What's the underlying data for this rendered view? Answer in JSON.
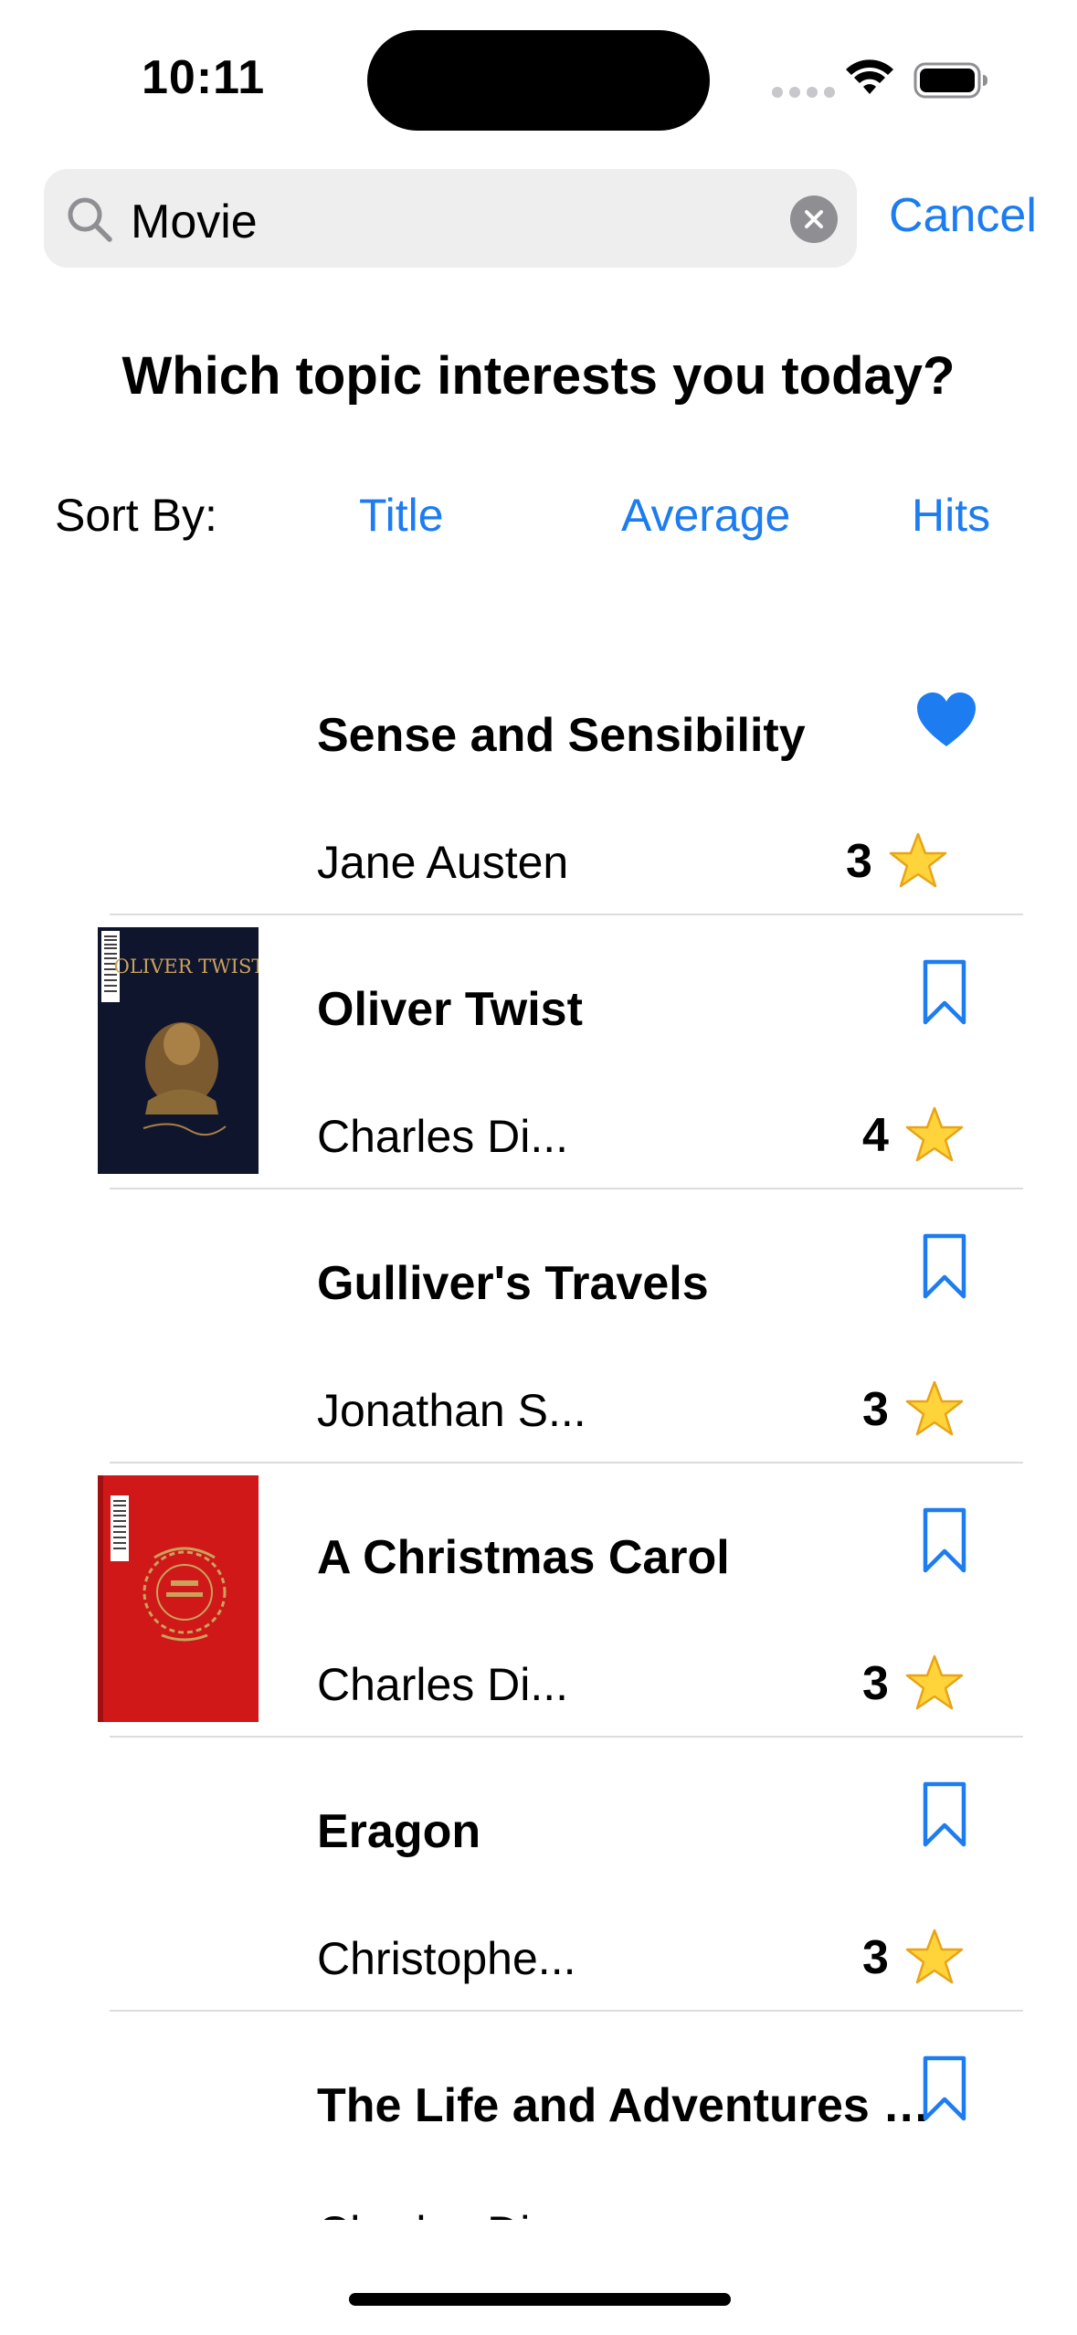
{
  "status_bar": {
    "time": "10:11"
  },
  "search": {
    "query": "Movie",
    "cancel_label": "Cancel"
  },
  "heading": "Which topic interests you today?",
  "sort": {
    "label": "Sort By:",
    "options": [
      "Title",
      "Average",
      "Hits"
    ]
  },
  "books": [
    {
      "title": "Sense and Sensibility",
      "author": "Jane Austen",
      "rating": "3",
      "icon": "heart-icon",
      "favorited": true
    },
    {
      "title": "Oliver Twist",
      "author": "Charles Di...",
      "rating": "4",
      "icon": "bookmark-icon",
      "cover": "oliver-twist-cover",
      "cover_text": "OLIVER TWIST"
    },
    {
      "title": "Gulliver's Travels",
      "author": "Jonathan S...",
      "rating": "3",
      "icon": "bookmark-icon"
    },
    {
      "title": "A Christmas Carol",
      "author": "Charles Di...",
      "rating": "3",
      "icon": "bookmark-icon",
      "cover": "christmas-carol-cover"
    },
    {
      "title": "Eragon",
      "author": "Christophe...",
      "rating": "3",
      "icon": "bookmark-icon"
    },
    {
      "title": "The Life and Adventures o...",
      "author": "Charles Di...",
      "rating": "",
      "icon": "bookmark-icon"
    }
  ],
  "colors": {
    "accent": "#1c7cf0",
    "search_bg": "#eeeeef",
    "divider": "#dcdcdf",
    "oliver_cover": "#10152e",
    "carol_cover": "#d01818"
  }
}
